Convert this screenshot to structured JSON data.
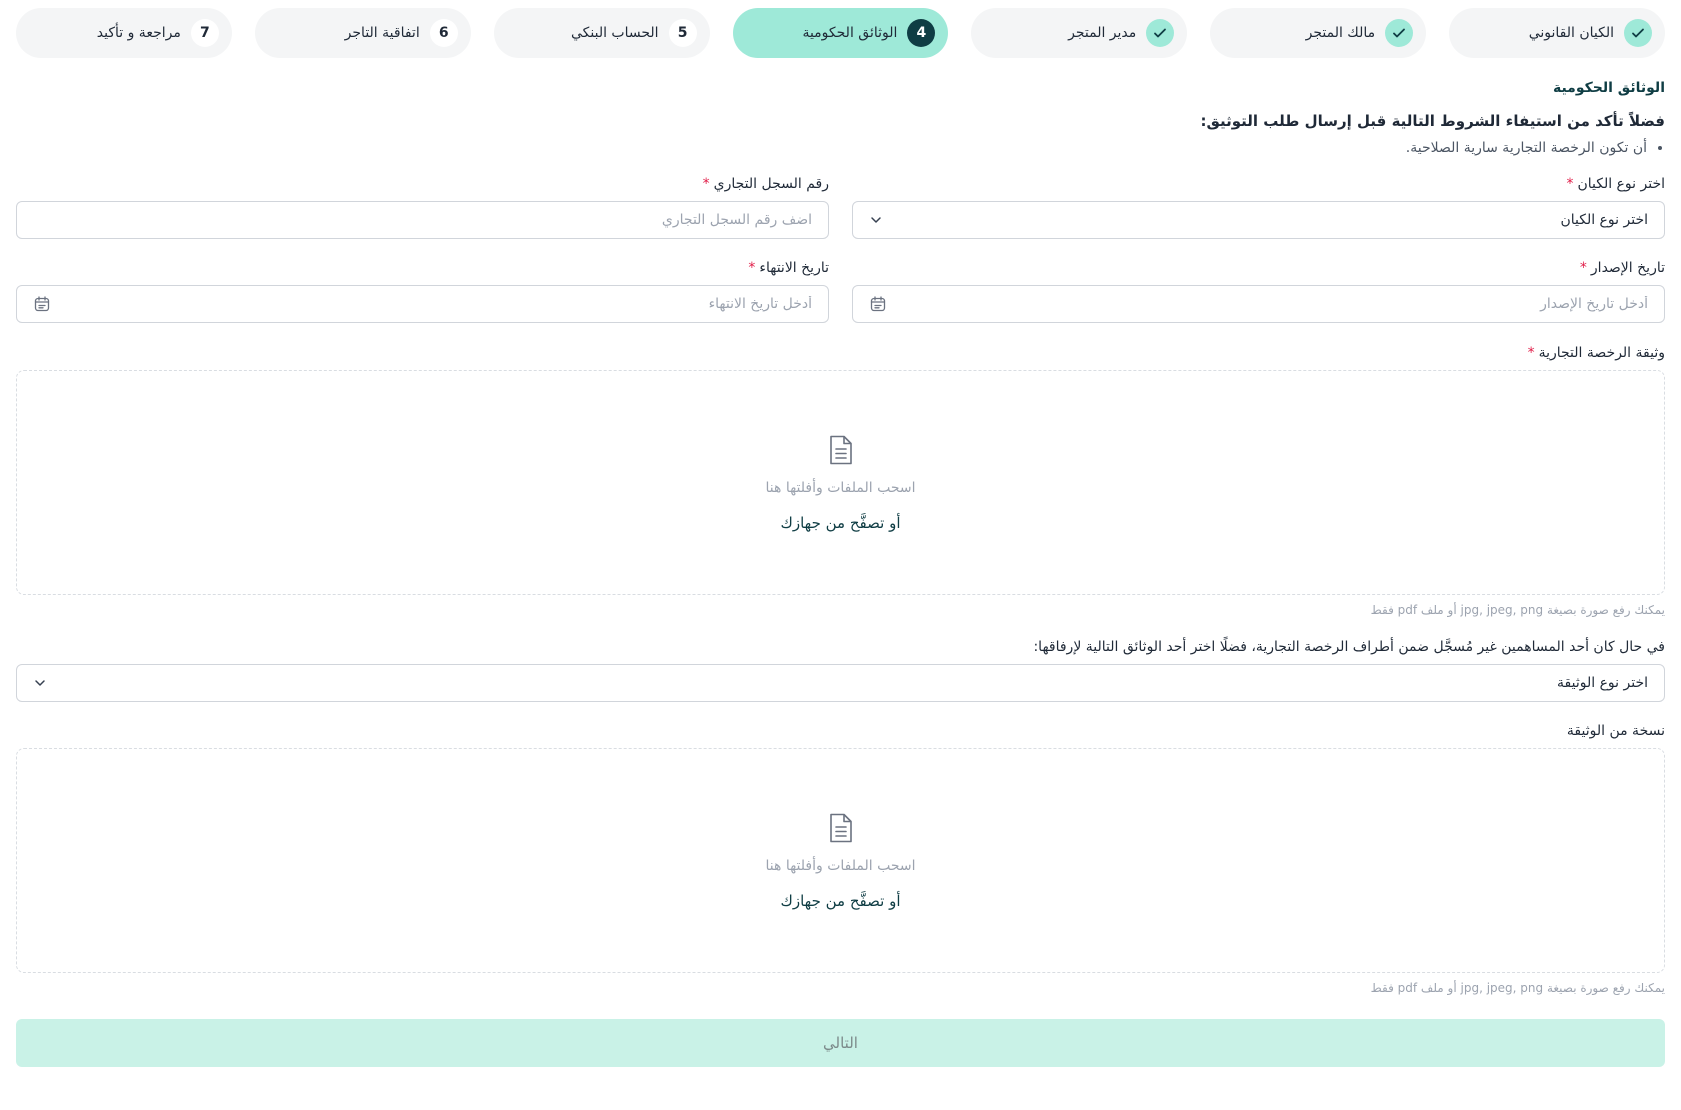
{
  "stepper": {
    "steps": [
      {
        "number": "",
        "label": "الكيان القانوني",
        "state": "done"
      },
      {
        "number": "",
        "label": "مالك المتجر",
        "state": "done"
      },
      {
        "number": "",
        "label": "مدير المتجر",
        "state": "done"
      },
      {
        "number": "4",
        "label": "الوثائق الحكومية",
        "state": "active"
      },
      {
        "number": "5",
        "label": "الحساب البنكي",
        "state": "pending"
      },
      {
        "number": "6",
        "label": "اتفاقية التاجر",
        "state": "pending"
      },
      {
        "number": "7",
        "label": "مراجعة و تأكيد",
        "state": "pending"
      }
    ]
  },
  "section": {
    "title": "الوثائق الحكومية",
    "instructions": "فضلاً تأكد من استيفاء الشروط التالية قبل إرسال طلب التوثيق:",
    "requirements": [
      "أن تكون الرخصة التجارية سارية الصلاحية."
    ]
  },
  "form": {
    "entity_type": {
      "label": "اختر نوع الكيان",
      "required_mark": "*",
      "value": "اختر نوع الكيان"
    },
    "cr_number": {
      "label": "رقم السجل التجاري",
      "required_mark": "*",
      "placeholder": "اضف رقم السجل التجاري"
    },
    "issue_date": {
      "label": "تاريخ الإصدار",
      "required_mark": "*",
      "placeholder": "أدخل تاريخ الإصدار"
    },
    "expiry_date": {
      "label": "تاريخ الانتهاء",
      "required_mark": "*",
      "placeholder": "أدخل تاريخ الانتهاء"
    },
    "license_doc": {
      "label": "وثيقة الرخصة التجارية",
      "required_mark": "*",
      "drag_text": "اسحب الملفات وأفلتها هنا",
      "browse_text": "أو تصفَّح من جهازك",
      "hint": "يمكنك رفع صورة بصيغة jpg, jpeg, png أو ملف pdf فقط"
    },
    "shareholder_doc_type": {
      "label": "في حال كان أحد المساهمين غير مُسجَّل ضمن أطراف الرخصة التجارية، فضلًا اختر أحد الوثائق التالية لإرفاقها:",
      "value": "اختر نوع الوثيقة"
    },
    "doc_copy": {
      "label": "نسخة من الوثيقة",
      "drag_text": "اسحب الملفات وأفلتها هنا",
      "browse_text": "أو تصفَّح من جهازك",
      "hint": "يمكنك رفع صورة بصيغة jpg, jpeg, png أو ملف pdf فقط"
    }
  },
  "actions": {
    "next_label": "التالي"
  },
  "colors": {
    "accent": "#9ee9d8",
    "accent_dark": "#0f3d44",
    "required": "#e11d48",
    "button_disabled": "#c9f2e7"
  },
  "icons": {
    "done": "check-icon",
    "dropdown": "chevron-down-icon",
    "date": "calendar-icon",
    "upload": "document-icon"
  }
}
